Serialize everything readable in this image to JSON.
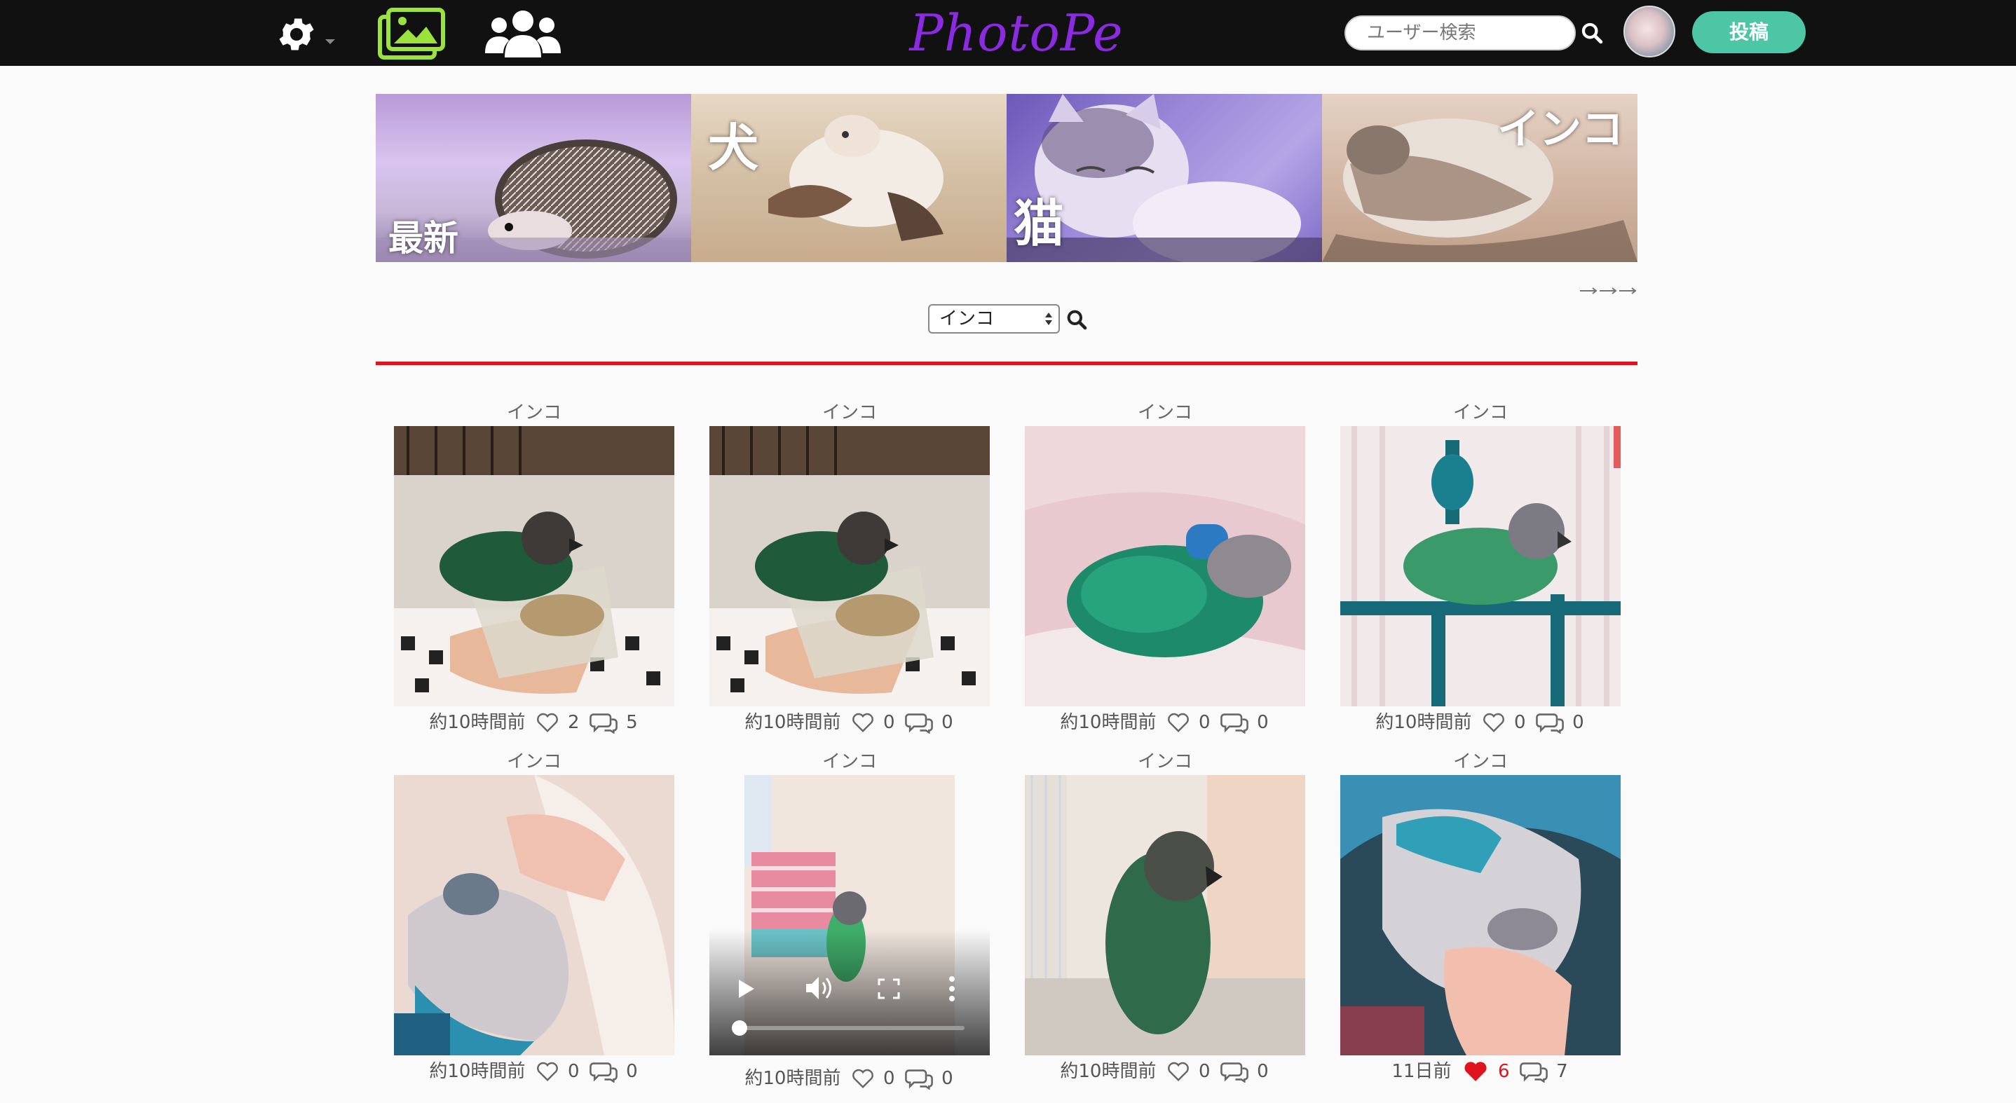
{
  "nav": {
    "logo": "PhotoPe",
    "search_placeholder": "ユーザー検索",
    "post_label": "投稿",
    "icons": [
      "gear-icon",
      "gallery-icon",
      "users-icon",
      "search-icon"
    ]
  },
  "categories": [
    {
      "label": "最新"
    },
    {
      "label": "犬"
    },
    {
      "label": "猫"
    },
    {
      "label": "インコ"
    }
  ],
  "filter": {
    "selected": "インコ"
  },
  "posts": [
    {
      "category": "インコ",
      "time": "約10時間前",
      "likes": "2",
      "comments": "5",
      "liked": false,
      "video": false
    },
    {
      "category": "インコ",
      "time": "約10時間前",
      "likes": "0",
      "comments": "0",
      "liked": false,
      "video": false
    },
    {
      "category": "インコ",
      "time": "約10時間前",
      "likes": "0",
      "comments": "0",
      "liked": false,
      "video": false
    },
    {
      "category": "インコ",
      "time": "約10時間前",
      "likes": "0",
      "comments": "0",
      "liked": false,
      "video": false
    },
    {
      "category": "インコ",
      "time": "約10時間前",
      "likes": "0",
      "comments": "0",
      "liked": false,
      "video": false
    },
    {
      "category": "インコ",
      "time": "約10時間前",
      "likes": "0",
      "comments": "0",
      "liked": false,
      "video": true
    },
    {
      "category": "インコ",
      "time": "約10時間前",
      "likes": "0",
      "comments": "0",
      "liked": false,
      "video": false
    },
    {
      "category": "インコ",
      "time": "11日前",
      "likes": "6",
      "comments": "7",
      "liked": true,
      "video": false
    }
  ],
  "colors": {
    "nav_bg": "#111111",
    "logo": "#8a2be2",
    "gallery_icon": "#9be23c",
    "post_button": "#4cc6a4",
    "divider": "#e0141e",
    "liked_heart": "#e0141e"
  }
}
